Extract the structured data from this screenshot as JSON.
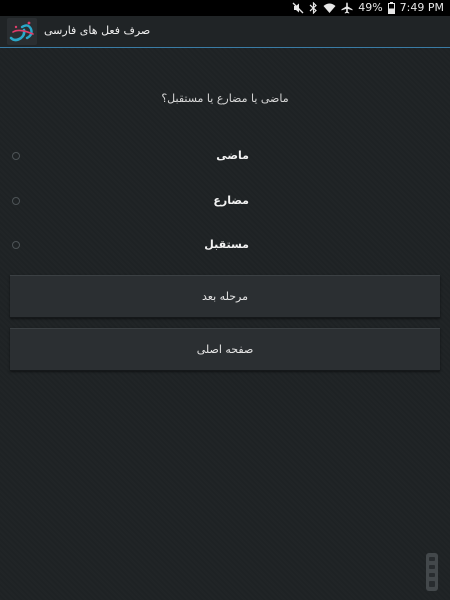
{
  "status_bar": {
    "battery": "49%",
    "time": "7:49 PM",
    "icons": [
      "signal-mute-icon",
      "bluetooth-icon",
      "wifi-icon",
      "airplane-mode-icon",
      "battery-icon"
    ]
  },
  "app_bar": {
    "title": "صرف فعل های فارسی",
    "logo_icon": "app-logo-icon"
  },
  "quiz": {
    "question": "ماضی یا مضارع یا مستقبل؟",
    "options": [
      {
        "label": "ماضی"
      },
      {
        "label": "مضارع"
      },
      {
        "label": "مستقبل"
      }
    ]
  },
  "buttons": {
    "next_label": "مرحله بعد",
    "home_label": "صفحه اصلی"
  },
  "colors": {
    "accent": "#3a7ca5",
    "background": "#1e2224",
    "button": "#2b2f32",
    "status_bar": "#000000"
  },
  "watermark": {
    "icon": "cafebazaar-watermark-icon"
  }
}
